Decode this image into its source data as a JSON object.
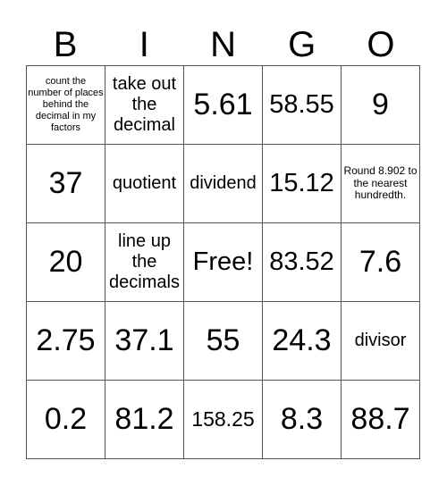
{
  "header": {
    "letters": [
      "B",
      "I",
      "N",
      "G",
      "O"
    ]
  },
  "cells": [
    [
      "count the number of places behind the decimal in my factors",
      "take out the decimal",
      "5.61",
      "58.55",
      "9"
    ],
    [
      "37",
      "quotient",
      "dividend",
      "15.12",
      "Round 8.902 to the nearest hundredth."
    ],
    [
      "20",
      "line up the decimals",
      "Free!",
      "83.52",
      "7.6"
    ],
    [
      "2.75",
      "37.1",
      "55",
      "24.3",
      "divisor"
    ],
    [
      "0.2",
      "81.2",
      "158.25",
      "8.3",
      "88.7"
    ]
  ]
}
